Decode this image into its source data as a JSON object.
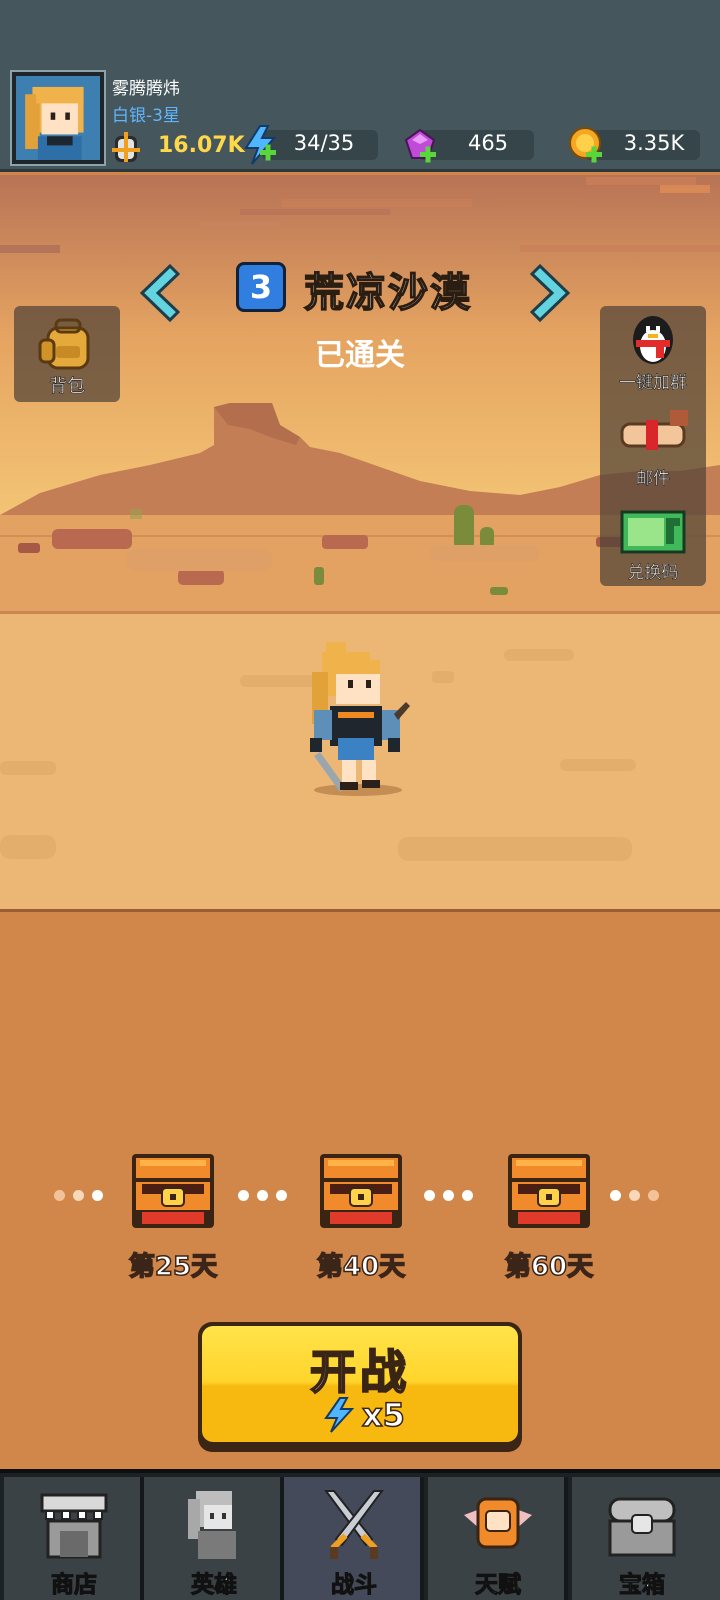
{
  "player": {
    "name": "雾腾腾炜",
    "rank": "白银-3星",
    "power": "16.07K"
  },
  "resources": [
    {
      "name": "energy",
      "icon": "lightning-plus-icon",
      "value": "34/35",
      "color": "#4fb6ff"
    },
    {
      "name": "gems",
      "icon": "purple-gem-plus-icon",
      "value": "465",
      "color": "#c04bd8"
    },
    {
      "name": "coins",
      "icon": "gold-coin-plus-icon",
      "value": "3.35K",
      "color": "#f5a623"
    }
  ],
  "stage": {
    "number": "3",
    "name": "荒凉沙漠",
    "status": "已通关"
  },
  "side_buttons": {
    "bag": "背包",
    "join_group": "一键加群",
    "mail": "邮件",
    "redeem": "兑换码"
  },
  "chests": [
    {
      "label": "第25天"
    },
    {
      "label": "第40天"
    },
    {
      "label": "第60天"
    }
  ],
  "start_button": {
    "label": "开战",
    "cost": "x5"
  },
  "nav": [
    {
      "label": "商店",
      "icon": "shop-icon"
    },
    {
      "label": "英雄",
      "icon": "hero-icon"
    },
    {
      "label": "战斗",
      "icon": "crossed-swords-icon"
    },
    {
      "label": "天赋",
      "icon": "talent-fist-icon"
    },
    {
      "label": "宝箱",
      "icon": "treasure-chest-icon"
    }
  ],
  "colors": {
    "header_bg": "#45565c",
    "sand": "#e9b46e",
    "ground": "#d2874a",
    "button_yellow": "#ffd52b"
  }
}
